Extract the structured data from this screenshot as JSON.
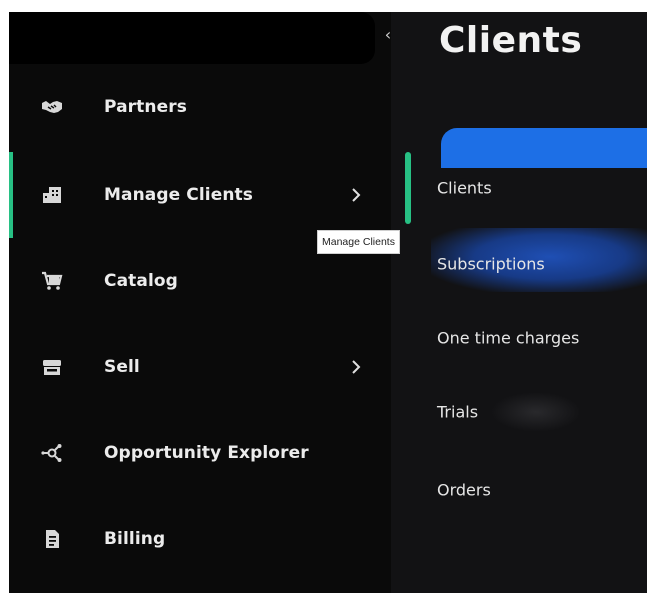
{
  "sidebar": {
    "collapse_glyph": "‹",
    "items": [
      {
        "label": "Partners",
        "icon": "handshake-icon",
        "has_chevron": false
      },
      {
        "label": "Manage Clients",
        "icon": "building-icon",
        "has_chevron": true,
        "active": true
      },
      {
        "label": "Catalog",
        "icon": "cart-icon",
        "has_chevron": false
      },
      {
        "label": "Sell",
        "icon": "store-icon",
        "has_chevron": true
      },
      {
        "label": "Opportunity Explorer",
        "icon": "network-icon",
        "has_chevron": false
      },
      {
        "label": "Billing",
        "icon": "document-icon",
        "has_chevron": false
      }
    ]
  },
  "submenu": {
    "title": "Clients",
    "items": [
      {
        "label": "Clients",
        "active": true
      },
      {
        "label": "Subscriptions",
        "highlighted": true
      },
      {
        "label": "One time charges"
      },
      {
        "label": "Trials"
      },
      {
        "label": "Orders"
      }
    ]
  },
  "tooltip": {
    "text": "Manage Clients"
  },
  "colors": {
    "accent_green": "#27c084",
    "accent_blue": "#1d6fe6",
    "background": "#0a0a0a",
    "text": "#ececec"
  }
}
